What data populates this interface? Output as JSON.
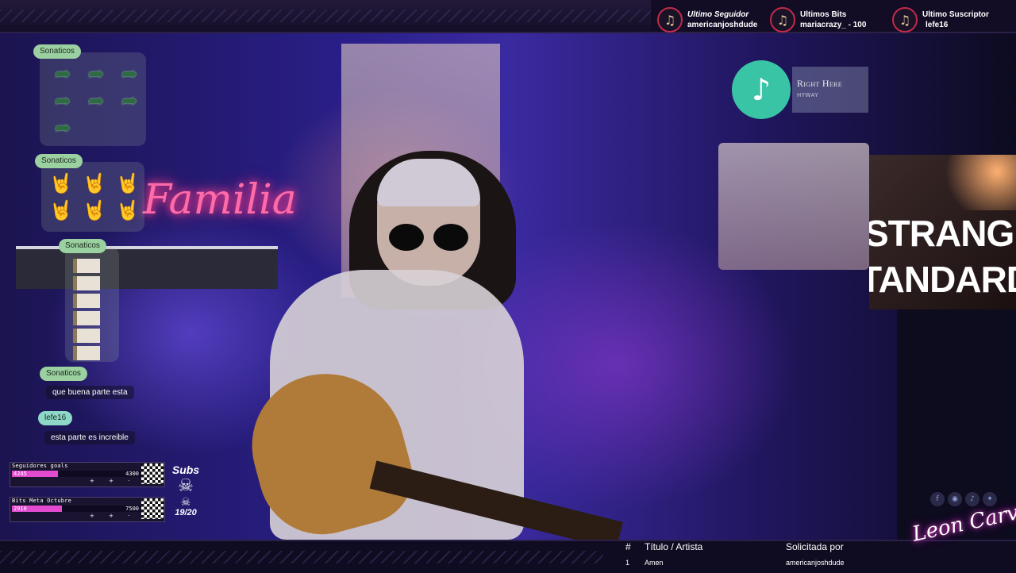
{
  "alerts": [
    {
      "label": "Ultimo Seguidor",
      "value": "americanjoshdude",
      "icon": "guitar-icon"
    },
    {
      "label": "Ultimos Bits",
      "value": "mariacrazy_ - 100",
      "icon": "guitar-icon"
    },
    {
      "label": "Ultimo Suscriptor",
      "value": "lefe16",
      "icon": "guitar-icon"
    }
  ],
  "now_playing": {
    "song": "Right Here",
    "artist": "HYWAY"
  },
  "chat": {
    "messages": [
      {
        "user": "Sonaticos",
        "text": ""
      },
      {
        "user": "Sonaticos",
        "text": ""
      },
      {
        "user": "Sonaticos",
        "text": ""
      },
      {
        "user": "Sonaticos",
        "text": "que buena parte esta"
      },
      {
        "user": "lefe16",
        "text": "esta parte es increible"
      }
    ]
  },
  "goals": [
    {
      "title": "Seguidores goals",
      "current": "4245",
      "target": "4300",
      "fill_fraction": 0.36,
      "color": "#e24bd0"
    },
    {
      "title": "Bits Meta Octubre",
      "current": "2910",
      "target": "7500",
      "fill_fraction": 0.39,
      "color": "#e24bd0"
    }
  ],
  "subs": {
    "label": "Subs",
    "count": "19/20"
  },
  "queue": {
    "headers": {
      "num": "#",
      "title": "Título / Artista",
      "requested": "Solicitada por"
    },
    "rows": [
      {
        "num": "1",
        "title": "Amen",
        "requested": "americanjoshdude"
      }
    ]
  },
  "logo_text": "Leon Carvajal",
  "neon_sign": "Familia",
  "poster_text": [
    "STRANGED",
    "TANDARD T"
  ],
  "socials": [
    "facebook-icon",
    "instagram-icon",
    "tiktok-icon",
    "twitter-icon"
  ],
  "colors": {
    "accent": "#3ac4a6",
    "alert_ring": "#c22a4a",
    "chat_name_bg": "#9bd0a0"
  }
}
